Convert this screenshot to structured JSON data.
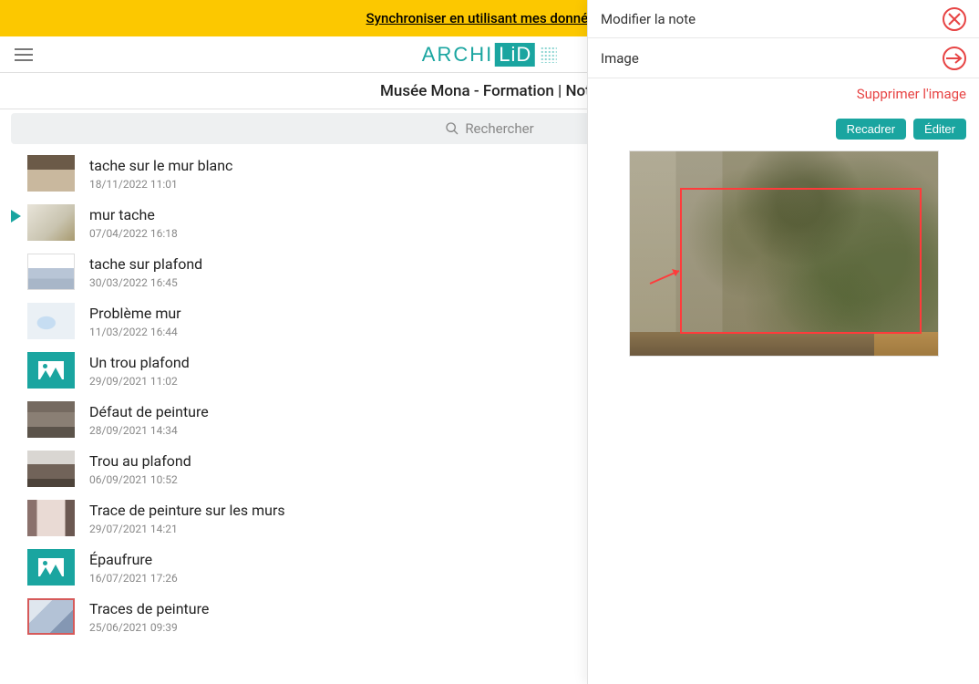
{
  "banner": {
    "text": "Synchroniser en utilisant mes données c"
  },
  "logo": {
    "part1": "ARCHI",
    "part2": "LiD"
  },
  "breadcrumb": "Musée Mona - Formation | Note",
  "search": {
    "placeholder": "Rechercher"
  },
  "notes": [
    {
      "title": "tache sur le mur blanc",
      "date": "18/11/2022 11:01",
      "thumb": "img1",
      "active": false
    },
    {
      "title": "mur tache",
      "date": "07/04/2022 16:18",
      "thumb": "img2",
      "active": true
    },
    {
      "title": "tache sur plafond",
      "date": "30/03/2022 16:45",
      "thumb": "img3",
      "active": false
    },
    {
      "title": "Problème mur",
      "date": "11/03/2022 16:44",
      "thumb": "img4",
      "active": false
    },
    {
      "title": "Un trou plafond",
      "date": "29/09/2021 11:02",
      "thumb": "ph",
      "active": false
    },
    {
      "title": "Défaut de peinture",
      "date": "28/09/2021 14:34",
      "thumb": "img5",
      "active": false
    },
    {
      "title": "Trou au plafond",
      "date": "06/09/2021 10:52",
      "thumb": "img6",
      "active": false
    },
    {
      "title": "Trace de peinture sur les murs",
      "date": "29/07/2021 14:21",
      "thumb": "img7",
      "active": false
    },
    {
      "title": "Épaufrure",
      "date": "16/07/2021 17:26",
      "thumb": "ph",
      "active": false
    },
    {
      "title": "Traces de peinture",
      "date": "25/06/2021 09:39",
      "thumb": "img8",
      "active": false
    }
  ],
  "panel": {
    "title": "Modifier la note",
    "section": "Image",
    "delete": "Supprimer l'image",
    "crop": "Recadrer",
    "edit": "Éditer"
  },
  "colors": {
    "accent": "#1AA5A0",
    "danger": "#E74444",
    "banner": "#FCC800"
  }
}
